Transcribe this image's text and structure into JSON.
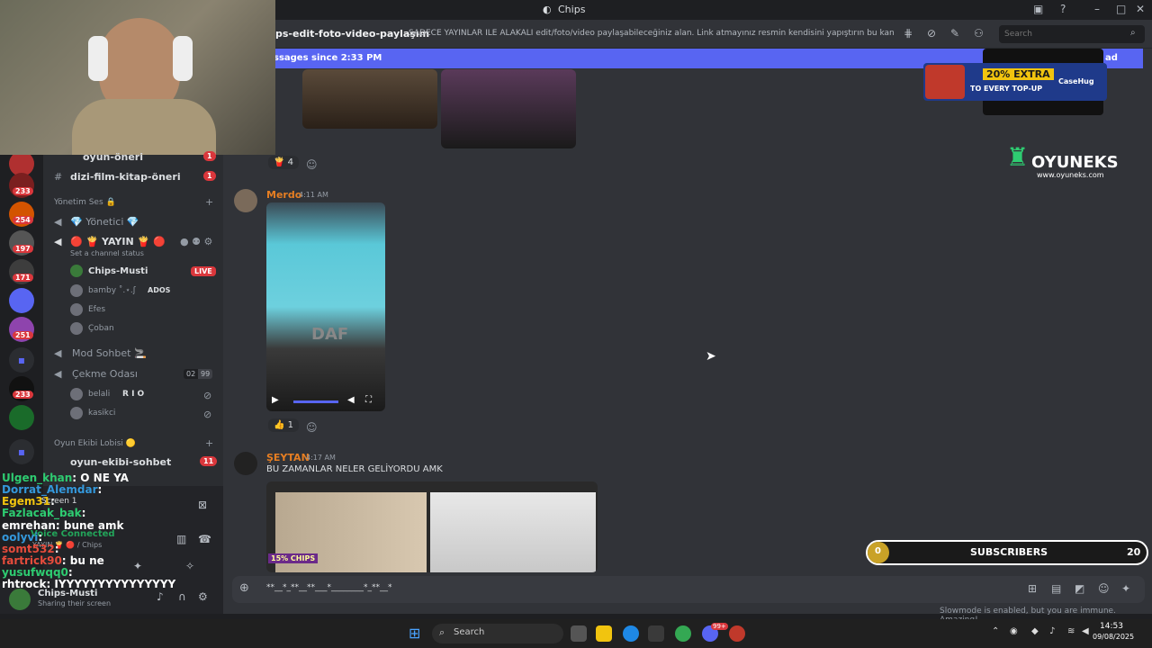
{
  "window": {
    "title": "Chips"
  },
  "header": {
    "channel": "ps-edit-foto-video-paylaşım",
    "topic": "SADECE YAYINLAR İLE ALAKALI edit/foto/video paylaşabileceğiniz alan. Link atmayınız resmin kendisini yapıştırın bu kanala lütfen, ...",
    "search_placeholder": "Search"
  },
  "new_messages_bar": {
    "text": "ssages since 2:33 PM",
    "mark": "ad"
  },
  "guild_badges": [
    "233",
    "254",
    "197",
    "171",
    "251",
    "233"
  ],
  "channels": {
    "items": [
      {
        "name": "oyun-öneri",
        "badge": "1"
      },
      {
        "name": "dizi-film-kitap-öneri",
        "badge": "1"
      }
    ],
    "category_voice": "Yönetim Ses 🔒",
    "yonetici": "💎 Yönetici 💎",
    "yayin": "🔴 🍟 YAYIN 🍟 🔴",
    "channel_status": "Set a channel status",
    "members": [
      {
        "name": "Chips-Musti",
        "tag": "LIVE"
      },
      {
        "name": "bamby ˚.⋆.ʃ",
        "tag": "ADOS"
      },
      {
        "name": "Efes",
        "tag": ""
      },
      {
        "name": "Çoban",
        "tag": ""
      }
    ],
    "mod_sohbet": "Mod Sohbet 🚬",
    "cekme_odasi": "Çekme Odası",
    "cekme_count_a": "02",
    "cekme_count_b": "99",
    "cekme_members": [
      {
        "name": "belali",
        "tag": "R I O"
      },
      {
        "name": "kasikci",
        "tag": ""
      }
    ],
    "category_lobi": "Oyun Ekibi Lobisi 🟡",
    "oyun_sohbet": "oyun-ekibi-sohbet",
    "oyun_sohbet_badge": "11"
  },
  "voice_panel": {
    "screen": "Screen 1",
    "connected": "Voice Connected",
    "location": "YAYIN 🍟 🔴 / Chips"
  },
  "user_panel": {
    "name": "Chips-Musti",
    "status": "Sharing their screen"
  },
  "overlay_chat": [
    {
      "user": "Ulgen_khan",
      "text": ": O NE YA",
      "color": "#2ecc71"
    },
    {
      "user": "Dorrat_Alemdar",
      "text": ":",
      "color": "#3498db"
    },
    {
      "user": "Egem31",
      "text": ":",
      "color": "#f1c40f"
    },
    {
      "user": "Fazlacak_bak",
      "text": ":",
      "color": "#2ecc71"
    },
    {
      "user": "emrehan",
      "text": ": bune amk",
      "color": "#ffffff"
    },
    {
      "user": "oolyvi",
      "text": ":",
      "color": "#3498db"
    },
    {
      "user": "somt532",
      "text": ":",
      "color": "#e74c3c"
    },
    {
      "user": "fartrick90",
      "text": ": bu ne",
      "color": "#e74c3c"
    },
    {
      "user": "yusufwqq0",
      "text": ":",
      "color": "#2ecc71"
    },
    {
      "user": "rhtrock",
      "text": ": IYYYYYYYYYYYYYYY",
      "color": "#ffffff"
    }
  ],
  "messages": [
    {
      "reaction_count": "4"
    },
    {
      "author": "Merdo",
      "time": "4:11 AM",
      "reaction_count": "1",
      "video_text": "DAF"
    },
    {
      "author": "ŞEYTAN",
      "time": "4:17 AM",
      "text": "BU ZAMANLAR NELER GELİYORDU AMK",
      "image_label": "15% CHIPS"
    }
  ],
  "composer": {
    "text": "**__*_**__**___*________*_**__*"
  },
  "slowmode": "Slowmode is enabled, but you are immune. Amazing!",
  "ad": {
    "line1": "20% EXTRA",
    "line2": "TO EVERY TOP-UP",
    "brand": "CaseHug"
  },
  "oyuneks": {
    "name": "OYUNEKS",
    "url": "www.oyuneks.com"
  },
  "subscribers": {
    "label": "SUBSCRIBERS",
    "current": "0",
    "goal": "20",
    "progress": 0
  },
  "taskbar": {
    "search": "Search",
    "time": "14:53",
    "date": "09/08/2025",
    "notif_count": "99+"
  }
}
